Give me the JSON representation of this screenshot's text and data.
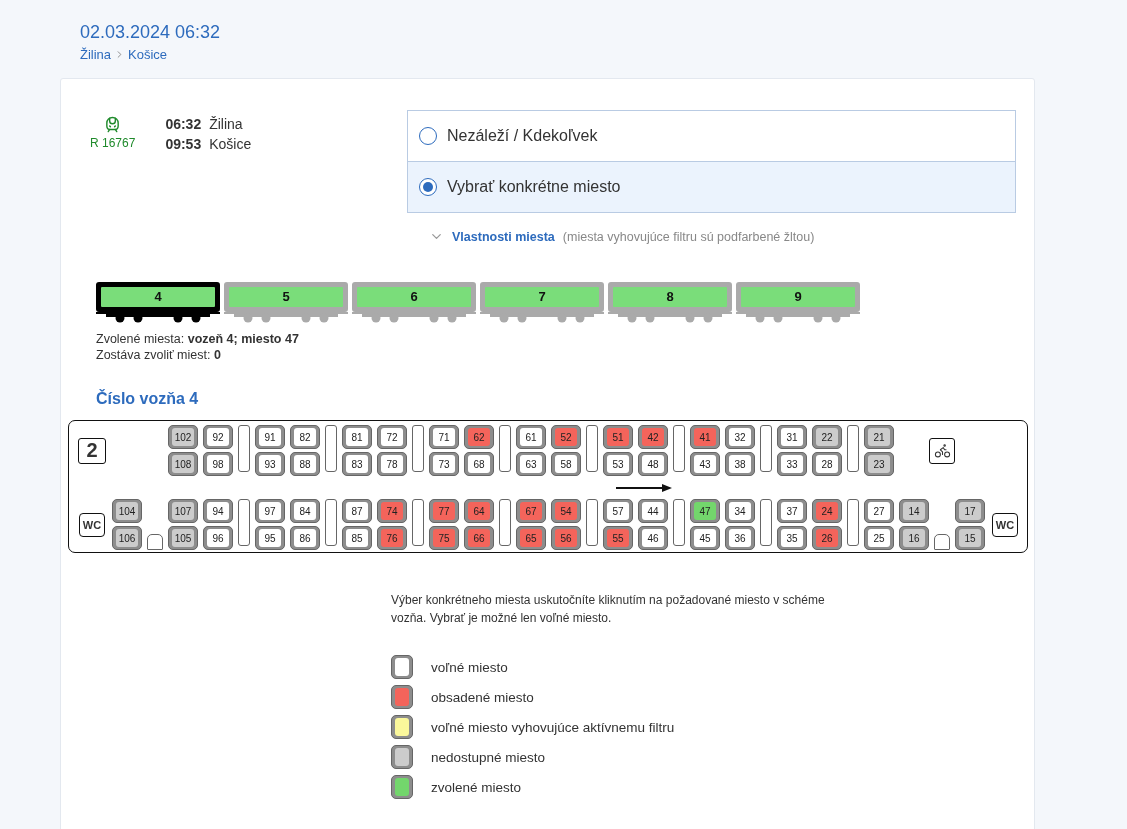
{
  "header": {
    "title": "02.03.2024 06:32",
    "route": [
      "Žilina",
      "Košice"
    ]
  },
  "train": {
    "number": "R 16767",
    "stops": [
      {
        "time": "06:32",
        "station": "Žilina"
      },
      {
        "time": "09:53",
        "station": "Košice"
      }
    ]
  },
  "seat_choice": [
    {
      "label": "Nezáleží / Kdekoľvek",
      "selected": false
    },
    {
      "label": "Vybrať konkrétne miesto",
      "selected": true
    }
  ],
  "filter_link": {
    "label": "Vlastnosti miesta",
    "note": "(miesta vyhovujúce filtru sú podfarbené žltou)"
  },
  "cars": [
    {
      "number": "4",
      "selected": true
    },
    {
      "number": "5",
      "selected": false
    },
    {
      "number": "6",
      "selected": false
    },
    {
      "number": "7",
      "selected": false
    },
    {
      "number": "8",
      "selected": false
    },
    {
      "number": "9",
      "selected": false
    }
  ],
  "selection": {
    "chosen": "Zvolené miesta: **vozeň 4; miesto 47**",
    "remaining": "Zostáva zvoliť miest: **0**"
  },
  "coach": {
    "title": "Číslo vozňa 4",
    "upper": [
      {
        "kind": "class",
        "label": "2"
      },
      {
        "kind": "gap"
      },
      {
        "kind": "gap"
      },
      {
        "kind": "seats",
        "seats": [
          {
            "number": "102",
            "color": "#cccccc"
          },
          {
            "number": "108",
            "color": "#cccccc"
          }
        ]
      },
      {
        "kind": "seats",
        "seats": [
          {
            "number": "92",
            "color": "#ffffff"
          },
          {
            "number": "98",
            "color": "#ffffff"
          }
        ]
      },
      {
        "kind": "table"
      },
      {
        "kind": "seats",
        "seats": [
          {
            "number": "91",
            "color": "#ffffff"
          },
          {
            "number": "93",
            "color": "#ffffff"
          }
        ]
      },
      {
        "kind": "seats",
        "seats": [
          {
            "number": "82",
            "color": "#ffffff"
          },
          {
            "number": "88",
            "color": "#ffffff"
          }
        ]
      },
      {
        "kind": "table"
      },
      {
        "kind": "seats",
        "seats": [
          {
            "number": "81",
            "color": "#ffffff"
          },
          {
            "number": "83",
            "color": "#ffffff"
          }
        ]
      },
      {
        "kind": "seats",
        "seats": [
          {
            "number": "72",
            "color": "#ffffff"
          },
          {
            "number": "78",
            "color": "#ffffff"
          }
        ]
      },
      {
        "kind": "table"
      },
      {
        "kind": "seats",
        "seats": [
          {
            "number": "71",
            "color": "#ffffff"
          },
          {
            "number": "73",
            "color": "#ffffff"
          }
        ]
      },
      {
        "kind": "seats",
        "seats": [
          {
            "number": "62",
            "color": "#f4645b"
          },
          {
            "number": "68",
            "color": "#ffffff"
          }
        ]
      },
      {
        "kind": "table"
      },
      {
        "kind": "seats",
        "seats": [
          {
            "number": "61",
            "color": "#ffffff"
          },
          {
            "number": "63",
            "color": "#ffffff"
          }
        ]
      },
      {
        "kind": "seats",
        "seats": [
          {
            "number": "52",
            "color": "#f4645b"
          },
          {
            "number": "58",
            "color": "#ffffff"
          }
        ]
      },
      {
        "kind": "table"
      },
      {
        "kind": "seats",
        "seats": [
          {
            "number": "51",
            "color": "#f4645b"
          },
          {
            "number": "53",
            "color": "#ffffff"
          }
        ]
      },
      {
        "kind": "seats",
        "seats": [
          {
            "number": "42",
            "color": "#f4645b"
          },
          {
            "number": "48",
            "color": "#ffffff"
          }
        ]
      },
      {
        "kind": "table"
      },
      {
        "kind": "seats",
        "seats": [
          {
            "number": "41",
            "color": "#f4645b"
          },
          {
            "number": "43",
            "color": "#ffffff"
          }
        ]
      },
      {
        "kind": "seats",
        "seats": [
          {
            "number": "32",
            "color": "#ffffff"
          },
          {
            "number": "38",
            "color": "#ffffff"
          }
        ]
      },
      {
        "kind": "table"
      },
      {
        "kind": "seats",
        "seats": [
          {
            "number": "31",
            "color": "#ffffff"
          },
          {
            "number": "33",
            "color": "#ffffff"
          }
        ]
      },
      {
        "kind": "seats",
        "seats": [
          {
            "number": "22",
            "color": "#cccccc"
          },
          {
            "number": "28",
            "color": "#ffffff"
          }
        ]
      },
      {
        "kind": "table"
      },
      {
        "kind": "seats",
        "seats": [
          {
            "number": "21",
            "color": "#cccccc"
          },
          {
            "number": "23",
            "color": "#cccccc"
          }
        ]
      },
      {
        "kind": "gap"
      },
      {
        "kind": "bike"
      },
      {
        "kind": "gap"
      },
      {
        "kind": "gap"
      }
    ],
    "lower": [
      {
        "kind": "wc",
        "label": "WC"
      },
      {
        "kind": "seats",
        "seats": [
          {
            "number": "104",
            "color": "#cccccc"
          },
          {
            "number": "106",
            "color": "#cccccc"
          }
        ]
      },
      {
        "kind": "step"
      },
      {
        "kind": "seats",
        "seats": [
          {
            "number": "107",
            "color": "#cccccc"
          },
          {
            "number": "105",
            "color": "#cccccc"
          }
        ]
      },
      {
        "kind": "seats",
        "seats": [
          {
            "number": "94",
            "color": "#ffffff"
          },
          {
            "number": "96",
            "color": "#ffffff"
          }
        ]
      },
      {
        "kind": "table"
      },
      {
        "kind": "seats",
        "seats": [
          {
            "number": "97",
            "color": "#ffffff"
          },
          {
            "number": "95",
            "color": "#ffffff"
          }
        ]
      },
      {
        "kind": "seats",
        "seats": [
          {
            "number": "84",
            "color": "#ffffff"
          },
          {
            "number": "86",
            "color": "#ffffff"
          }
        ]
      },
      {
        "kind": "table"
      },
      {
        "kind": "seats",
        "seats": [
          {
            "number": "87",
            "color": "#ffffff"
          },
          {
            "number": "85",
            "color": "#ffffff"
          }
        ]
      },
      {
        "kind": "seats",
        "seats": [
          {
            "number": "74",
            "color": "#f4645b"
          },
          {
            "number": "76",
            "color": "#f4645b"
          }
        ]
      },
      {
        "kind": "table"
      },
      {
        "kind": "seats",
        "seats": [
          {
            "number": "77",
            "color": "#f4645b"
          },
          {
            "number": "75",
            "color": "#f4645b"
          }
        ]
      },
      {
        "kind": "seats",
        "seats": [
          {
            "number": "64",
            "color": "#f4645b"
          },
          {
            "number": "66",
            "color": "#f4645b"
          }
        ]
      },
      {
        "kind": "table"
      },
      {
        "kind": "seats",
        "seats": [
          {
            "number": "67",
            "color": "#f4645b"
          },
          {
            "number": "65",
            "color": "#f4645b"
          }
        ]
      },
      {
        "kind": "seats",
        "seats": [
          {
            "number": "54",
            "color": "#f4645b"
          },
          {
            "number": "56",
            "color": "#f4645b"
          }
        ]
      },
      {
        "kind": "table"
      },
      {
        "kind": "seats",
        "seats": [
          {
            "number": "57",
            "color": "#ffffff"
          },
          {
            "number": "55",
            "color": "#f4645b"
          }
        ]
      },
      {
        "kind": "seats",
        "seats": [
          {
            "number": "44",
            "color": "#ffffff"
          },
          {
            "number": "46",
            "color": "#ffffff"
          }
        ]
      },
      {
        "kind": "table"
      },
      {
        "kind": "seats",
        "seats": [
          {
            "number": "47",
            "color": "#73d66c"
          },
          {
            "number": "45",
            "color": "#ffffff"
          }
        ]
      },
      {
        "kind": "seats",
        "seats": [
          {
            "number": "34",
            "color": "#ffffff"
          },
          {
            "number": "36",
            "color": "#ffffff"
          }
        ]
      },
      {
        "kind": "table"
      },
      {
        "kind": "seats",
        "seats": [
          {
            "number": "37",
            "color": "#ffffff"
          },
          {
            "number": "35",
            "color": "#ffffff"
          }
        ]
      },
      {
        "kind": "seats",
        "seats": [
          {
            "number": "24",
            "color": "#f4645b"
          },
          {
            "number": "26",
            "color": "#f4645b"
          }
        ]
      },
      {
        "kind": "table"
      },
      {
        "kind": "seats",
        "seats": [
          {
            "number": "27",
            "color": "#ffffff"
          },
          {
            "number": "25",
            "color": "#ffffff"
          }
        ]
      },
      {
        "kind": "seats",
        "seats": [
          {
            "number": "14",
            "color": "#cccccc"
          },
          {
            "number": "16",
            "color": "#cccccc"
          }
        ]
      },
      {
        "kind": "step"
      },
      {
        "kind": "seats",
        "seats": [
          {
            "number": "17",
            "color": "#cccccc"
          },
          {
            "number": "15",
            "color": "#cccccc"
          }
        ]
      },
      {
        "kind": "wc",
        "label": "WC"
      }
    ]
  },
  "instructions": "Výber konkrétneho miesta uskutočníte kliknutím na požadované miesto v schéme vozňa. Vybrať je možné len voľné miesto.",
  "legend": [
    {
      "color": "#ffffff",
      "label": "voľné miesto"
    },
    {
      "color": "#f4645b",
      "label": "obsadené miesto"
    },
    {
      "color": "#fbf89b",
      "label": "voľné miesto vyhovujúce aktívnemu filtru"
    },
    {
      "color": "#cccccc",
      "label": "nedostupné miesto"
    },
    {
      "color": "#73d66c",
      "label": "zvolené miesto"
    }
  ]
}
